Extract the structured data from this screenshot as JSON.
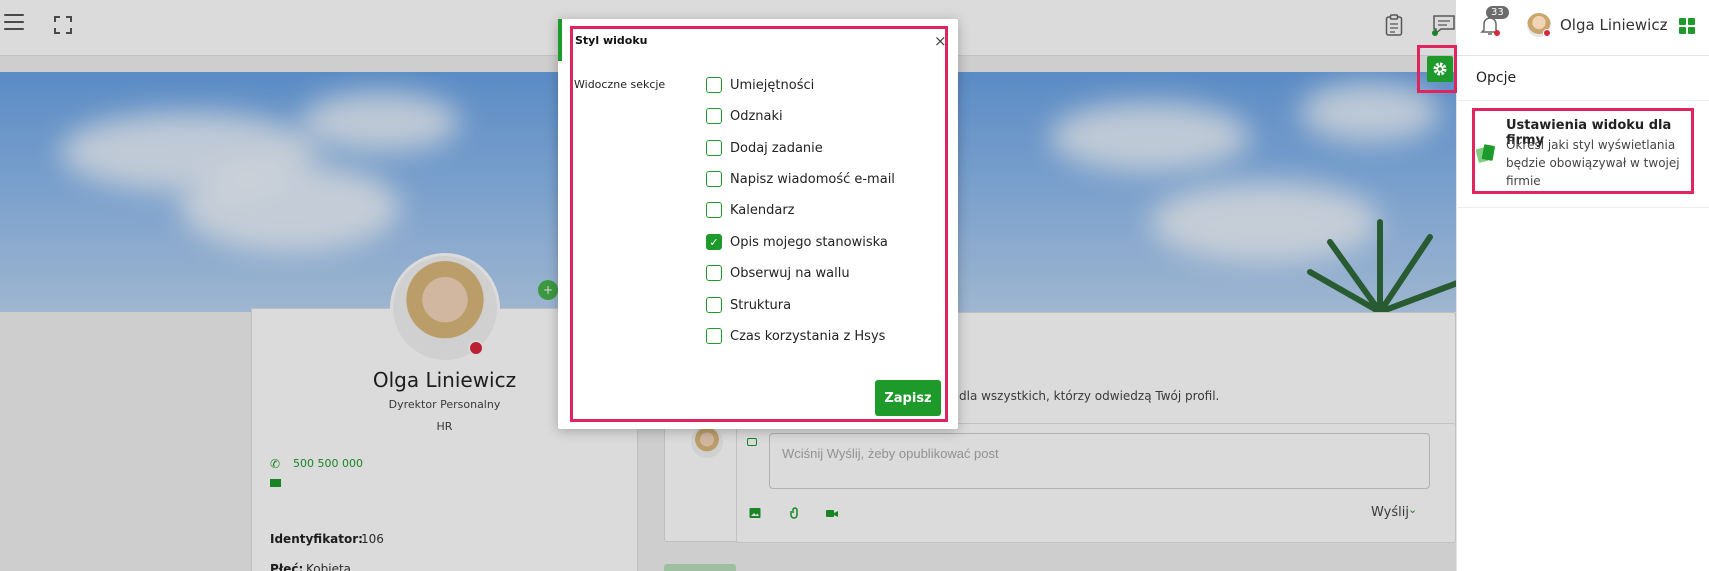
{
  "topbar": {
    "notifications_count": "33",
    "user_name": "Olga Liniewicz"
  },
  "profile": {
    "name": "Olga Liniewicz",
    "position": "Dyrektor Personalny",
    "department": "HR",
    "phone": "500 500 000",
    "fields": [
      {
        "label": "Identyfikator:",
        "value": "106"
      },
      {
        "label": "Płeć:",
        "value": "Kobieta"
      }
    ]
  },
  "wall": {
    "info_text": "dla wszystkich, którzy odwiedzą Twój profil.",
    "post_placeholder": "Wciśnij Wyślij, żeby opublikować post",
    "send_label": "Wyślij"
  },
  "options_panel": {
    "title": "Opcje",
    "item_title": "Ustawienia widoku dla firmy",
    "item_description": "Określ jaki styl wyświetlania będzie obowiązywał w twojej firmie"
  },
  "modal": {
    "title": "Styl widoku",
    "close_symbol": "×",
    "section_label": "Widoczne sekcje",
    "save_label": "Zapisz",
    "checkboxes": [
      {
        "label": "Umiejętności",
        "checked": false
      },
      {
        "label": "Odznaki",
        "checked": false
      },
      {
        "label": "Dodaj zadanie",
        "checked": false
      },
      {
        "label": "Napisz wiadomość e-mail",
        "checked": false
      },
      {
        "label": "Kalendarz",
        "checked": false
      },
      {
        "label": "Opis mojego stanowiska",
        "checked": true
      },
      {
        "label": "Obserwuj na wallu",
        "checked": false
      },
      {
        "label": "Struktura",
        "checked": false
      },
      {
        "label": "Czas korzystania z Hsys",
        "checked": false
      }
    ]
  },
  "colors": {
    "accent_green": "#1e9a2b",
    "highlight_red": "#e0245e",
    "status_red": "#d9283c"
  }
}
